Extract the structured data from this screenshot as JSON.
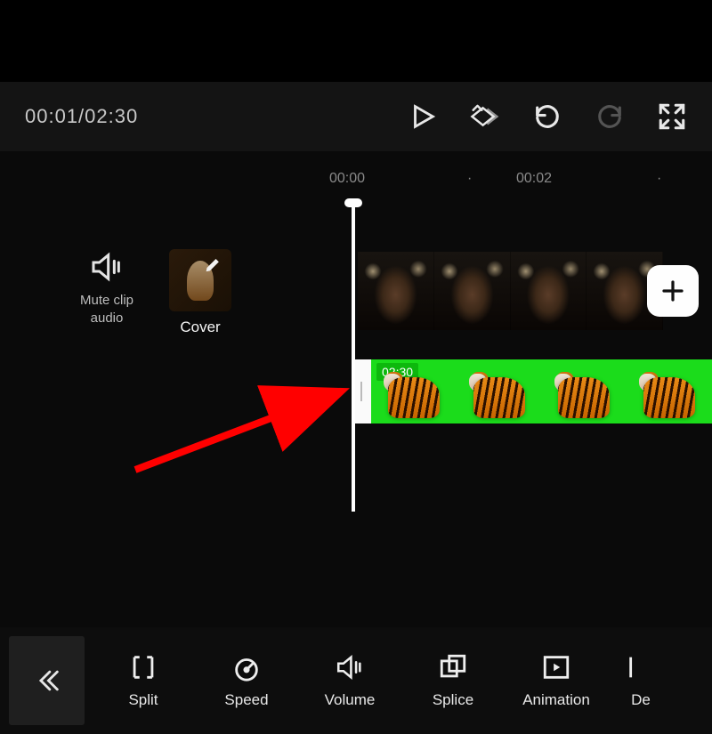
{
  "playback": {
    "current": "00:01",
    "total": "02:30",
    "display": "00:01/02:30"
  },
  "topControls": {
    "play": "play-icon",
    "keyframe": "add-keyframe-icon",
    "undo": "undo-icon",
    "redo": "redo-icon",
    "fullscreen": "fullscreen-icon"
  },
  "ruler": {
    "tick0": "00:00",
    "tick1": "00:02"
  },
  "side": {
    "muteLabel": "Mute clip\naudio",
    "coverLabel": "Cover"
  },
  "tracks": {
    "overlayDuration": "02:30"
  },
  "toolbar": {
    "back": "back-button",
    "items": [
      {
        "icon": "split-icon",
        "label": "Split"
      },
      {
        "icon": "speed-icon",
        "label": "Speed"
      },
      {
        "icon": "volume-icon",
        "label": "Volume"
      },
      {
        "icon": "splice-icon",
        "label": "Splice"
      },
      {
        "icon": "animation-icon",
        "label": "Animation"
      },
      {
        "icon": "delete-icon",
        "label": "De"
      }
    ]
  },
  "colors": {
    "greenScreen": "#1bdc1b",
    "arrow": "#ff0000"
  }
}
